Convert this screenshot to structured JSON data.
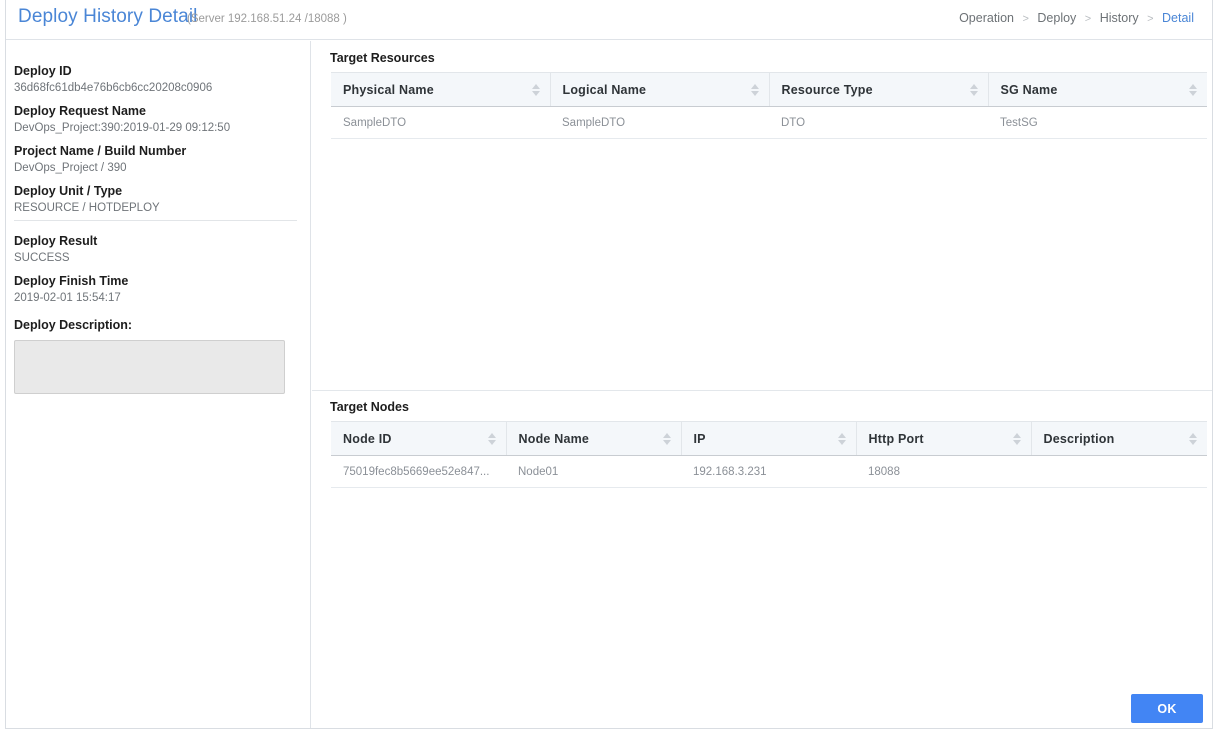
{
  "header": {
    "title": "Deploy History Detail",
    "server_info": "(Server 192.168.51.24 /18088 )",
    "breadcrumb": [
      {
        "label": "Operation",
        "active": false
      },
      {
        "label": "Deploy",
        "active": false
      },
      {
        "label": "History",
        "active": false
      },
      {
        "label": "Detail",
        "active": true
      }
    ],
    "breadcrumb_separator": ">"
  },
  "details": {
    "fields": [
      {
        "label": "Deploy ID",
        "value": "36d68fc61db4e76b6cb6cc20208c0906"
      },
      {
        "label": "Deploy Request Name",
        "value": "DevOps_Project:390:2019-01-29 09:12:50"
      },
      {
        "label": "Project Name / Build Number",
        "value": "DevOps_Project / 390"
      },
      {
        "label": "Deploy Unit / Type",
        "value": "RESOURCE / HOTDEPLOY"
      },
      {
        "label": "Deploy Result",
        "value": "SUCCESS"
      },
      {
        "label": "Deploy Finish Time",
        "value": "2019-02-01 15:54:17"
      }
    ],
    "description_label": "Deploy Description:",
    "description_value": "",
    "description_placeholder": ""
  },
  "target_resources": {
    "title": "Target Resources",
    "columns": [
      "Physical Name",
      "Logical Name",
      "Resource Type",
      "SG Name"
    ],
    "rows": [
      [
        "SampleDTO",
        "SampleDTO",
        "DTO",
        "TestSG"
      ]
    ]
  },
  "target_nodes": {
    "title": "Target Nodes",
    "columns": [
      "Node ID",
      "Node Name",
      "IP",
      "Http Port",
      "Description"
    ],
    "rows": [
      [
        "75019fec8b5669ee52e847...",
        "Node01",
        "192.168.3.231",
        "18088",
        ""
      ]
    ]
  },
  "footer": {
    "ok_label": "OK"
  },
  "colors": {
    "accent": "#4a86d6",
    "button": "#4285f4",
    "header_row": "#f4f7fa",
    "value_text": "#6f7479"
  }
}
